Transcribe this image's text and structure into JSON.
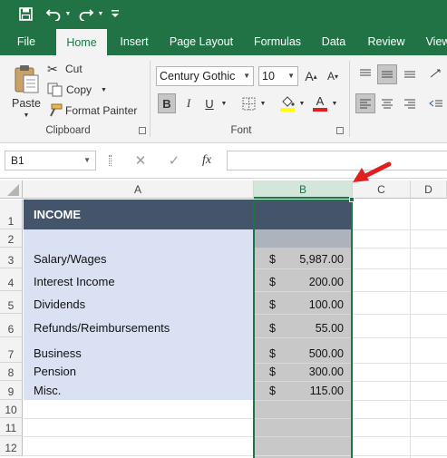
{
  "qat": {
    "save_icon": "save-icon",
    "undo_icon": "undo-icon",
    "redo_icon": "redo-icon",
    "customize_icon": "customize-qat-icon"
  },
  "tabs": [
    "File",
    "Home",
    "Insert",
    "Page Layout",
    "Formulas",
    "Data",
    "Review",
    "View"
  ],
  "active_tab": "Home",
  "clipboard": {
    "paste": "Paste",
    "cut": "Cut",
    "copy": "Copy",
    "format_painter": "Format Painter",
    "label": "Clipboard"
  },
  "font": {
    "name": "Century Gothic",
    "size": "10",
    "bold": "B",
    "label": "Font"
  },
  "formula_bar": {
    "name_box": "B1",
    "fx": "fx",
    "value": ""
  },
  "columns": [
    "A",
    "B",
    "C",
    "D"
  ],
  "rows": [
    {
      "num": "1",
      "label": "INCOME",
      "currency": "",
      "amount": ""
    },
    {
      "num": "2",
      "label": "",
      "currency": "",
      "amount": ""
    },
    {
      "num": "3",
      "label": "Salary/Wages",
      "currency": "$",
      "amount": "5,987.00"
    },
    {
      "num": "4",
      "label": "Interest Income",
      "currency": "$",
      "amount": "200.00"
    },
    {
      "num": "5",
      "label": "Dividends",
      "currency": "$",
      "amount": "100.00"
    },
    {
      "num": "6",
      "label": "Refunds/Reimbursements",
      "currency": "$",
      "amount": "55.00"
    },
    {
      "num": "7",
      "label": "Business",
      "currency": "$",
      "amount": "500.00"
    },
    {
      "num": "8",
      "label": "Pension",
      "currency": "$",
      "amount": "300.00"
    },
    {
      "num": "9",
      "label": "Misc.",
      "currency": "$",
      "amount": "115.00"
    },
    {
      "num": "10",
      "label": "",
      "currency": "",
      "amount": ""
    },
    {
      "num": "11",
      "label": "",
      "currency": "",
      "amount": ""
    },
    {
      "num": "12",
      "label": "",
      "currency": "",
      "amount": ""
    }
  ],
  "selected_column": "B",
  "colors": {
    "excel_green": "#217346",
    "header_fill": "#44546a",
    "income_fill": "#d9e1f2",
    "selection_fill": "#c8c8c8",
    "arrow": "#e02020"
  }
}
